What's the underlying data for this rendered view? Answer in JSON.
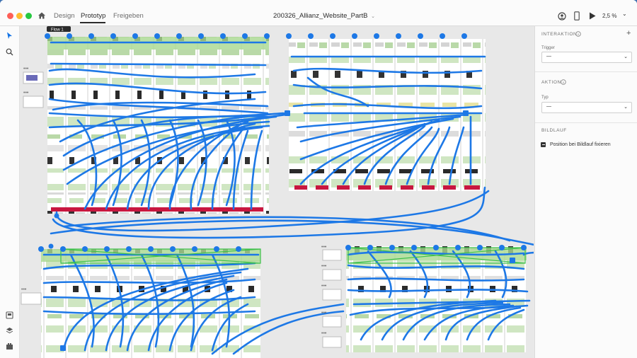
{
  "window": {
    "title": "200326_Allianz_Website_PartB",
    "zoom": "2,5 %"
  },
  "tabs": [
    {
      "label": "Design"
    },
    {
      "label": "Prototyp"
    },
    {
      "label": "Freigeben"
    }
  ],
  "canvas": {
    "flow_label": "Flow 1"
  },
  "panel": {
    "interaction": {
      "title": "INTERAKTION",
      "trigger_label": "Trigger",
      "trigger_value": "—"
    },
    "action": {
      "title": "AKTION",
      "type_label": "Typ",
      "type_value": "—"
    },
    "scroll": {
      "title": "BILDLAUF",
      "fix_label": "Position bei Bildlauf fixieren"
    }
  },
  "colors": {
    "wire": "#1d78e6",
    "artboard_green": "#cfe6c2",
    "accent_red": "#c8173f"
  }
}
